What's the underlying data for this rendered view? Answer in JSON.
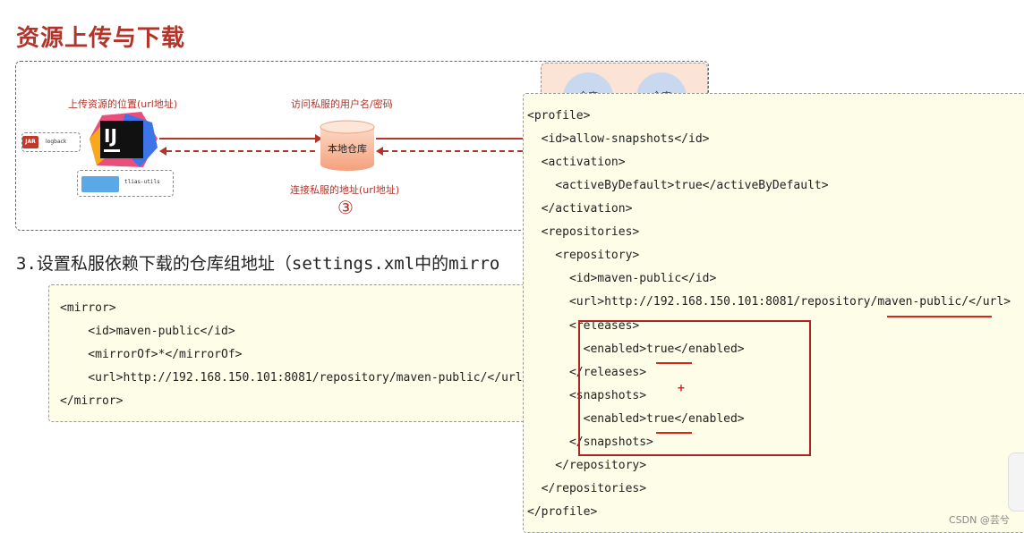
{
  "title": "资源上传与下载",
  "diagram": {
    "label_upload": "上传资源的位置(url地址)",
    "label_auth": "访问私服的用户名/密码",
    "label_connect": "连接私服的地址(url地址)",
    "db_label": "本地仓库",
    "circled_num": "③",
    "jar_badge": "JAR",
    "jar_name": "logback",
    "folder_name": "tlias-utils",
    "ij_label": "IJ",
    "mini_repo_1": "仓库",
    "mini_repo_2": "仓库"
  },
  "step3_text": "3.设置私服依赖下载的仓库组地址（settings.xml中的mirro",
  "mirror": {
    "l1": "<mirror>",
    "l2": "    <id>maven-public</id>",
    "l3": "    <mirrorOf>*</mirrorOf>",
    "l4": "    <url>http://192.168.150.101:8081/repository/maven-public/</url>",
    "l5": "</mirror>"
  },
  "profile": {
    "l1": "<profile>",
    "l2": "  <id>allow-snapshots</id>",
    "l3": "  <activation>",
    "l4": "    <activeByDefault>true</activeByDefault>",
    "l5": "  </activation>",
    "l6": "  <repositories>",
    "l7": "    <repository>",
    "l8": "      <id>maven-public</id>",
    "l9": "      <url>http://192.168.150.101:8081/repository/maven-public/</url>",
    "l10": "      <releases>",
    "l11": "        <enabled>true</enabled>",
    "l12": "      </releases>",
    "l13": "      <snapshots>",
    "l14": "        <enabled>true</enabled>",
    "l15": "      </snapshots>",
    "l16": "    </repository>",
    "l17": "  </repositories>",
    "l18": "</profile>",
    "plus": "+"
  },
  "watermark": "CSDN @芸兮",
  "colors": {
    "accent_red": "#b2342a",
    "code_bg": "#fdfde8",
    "tag_blue": "#1a3c8a"
  }
}
